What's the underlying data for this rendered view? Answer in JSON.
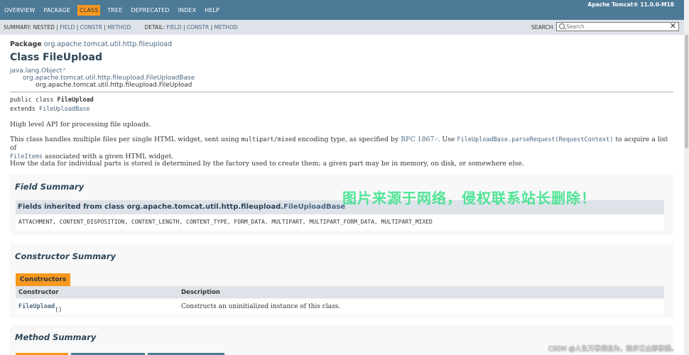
{
  "topnav": {
    "items": [
      "OVERVIEW",
      "PACKAGE",
      "CLASS",
      "TREE",
      "DEPRECATED",
      "INDEX",
      "HELP"
    ],
    "active_index": 2,
    "about": "Apache Tomcat® 11.0.0-M18"
  },
  "subnav": {
    "summary_label": "SUMMARY:",
    "summary_nested": "NESTED",
    "summary_field": "FIELD",
    "summary_constr": "CONSTR",
    "summary_method": "METHOD",
    "detail_label": "DETAIL:",
    "detail_field": "FIELD",
    "detail_constr": "CONSTR",
    "detail_method": "METHOD",
    "sep": "|",
    "search_label": "SEARCH",
    "search_placeholder": "Search",
    "reset_glyph": "✕"
  },
  "header": {
    "package_label": "Package",
    "package_name": "org.apache.tomcat.util.http.fileupload",
    "class_title": "Class FileUpload"
  },
  "inheritance": {
    "root": "java.lang.Object",
    "parent": "org.apache.tomcat.util.http.fileupload.FileUploadBase",
    "current": "org.apache.tomcat.util.http.fileupload.FileUpload"
  },
  "declaration": {
    "prefix": "public class ",
    "class_name": "FileUpload",
    "extends_kw": "extends ",
    "extends_name": "FileUploadBase"
  },
  "description": {
    "p1": "High level API for processing file uploads.",
    "p2_a": "This class handles multiple files per single HTML widget, sent using ",
    "p2_code": "multipart/mixed",
    "p2_b": " encoding type, as specified by ",
    "p2_rfc": "RFC 1867",
    "p2_c": ". Use ",
    "p2_method": "FileUploadBase.parseRequest(RequestContext)",
    "p2_d": " to acquire a list of",
    "p2_fileitems": "FileItems",
    "p2_e": " associated with a given HTML widget.",
    "p3": "How the data for individual parts is stored is determined by the factory used to create them; a given part may be in memory, on disk, or somewhere else."
  },
  "field_summary": {
    "heading": "Field Summary",
    "inherited_prefix": "Fields inherited from class org.apache.tomcat.util.http.fileupload.",
    "inherited_link": "FileUploadBase",
    "fields": "ATTACHMENT, CONTENT_DISPOSITION, CONTENT_LENGTH, CONTENT_TYPE, FORM_DATA, MULTIPART, MULTIPART_FORM_DATA, MULTIPART_MIXED"
  },
  "constructor_summary": {
    "heading": "Constructor Summary",
    "tab": "Constructors",
    "col_constructor": "Constructor",
    "col_description": "Description",
    "row_name": "FileUpload",
    "row_parens": "()",
    "row_desc": "Constructs an uninitialized instance of this class."
  },
  "method_summary": {
    "heading": "Method Summary"
  },
  "overlay": {
    "watermark": "图片来源于网络，侵权联系站长删除！",
    "csdn": "CSDN @人生万事须自为，跬步江山即寥廓。"
  },
  "colors": {
    "nav_bg": "#4d7a97",
    "subnav_bg": "#dee3e9",
    "active_tab": "#f8981d",
    "link": "#4a6782",
    "watermark": "#3fe28c"
  }
}
